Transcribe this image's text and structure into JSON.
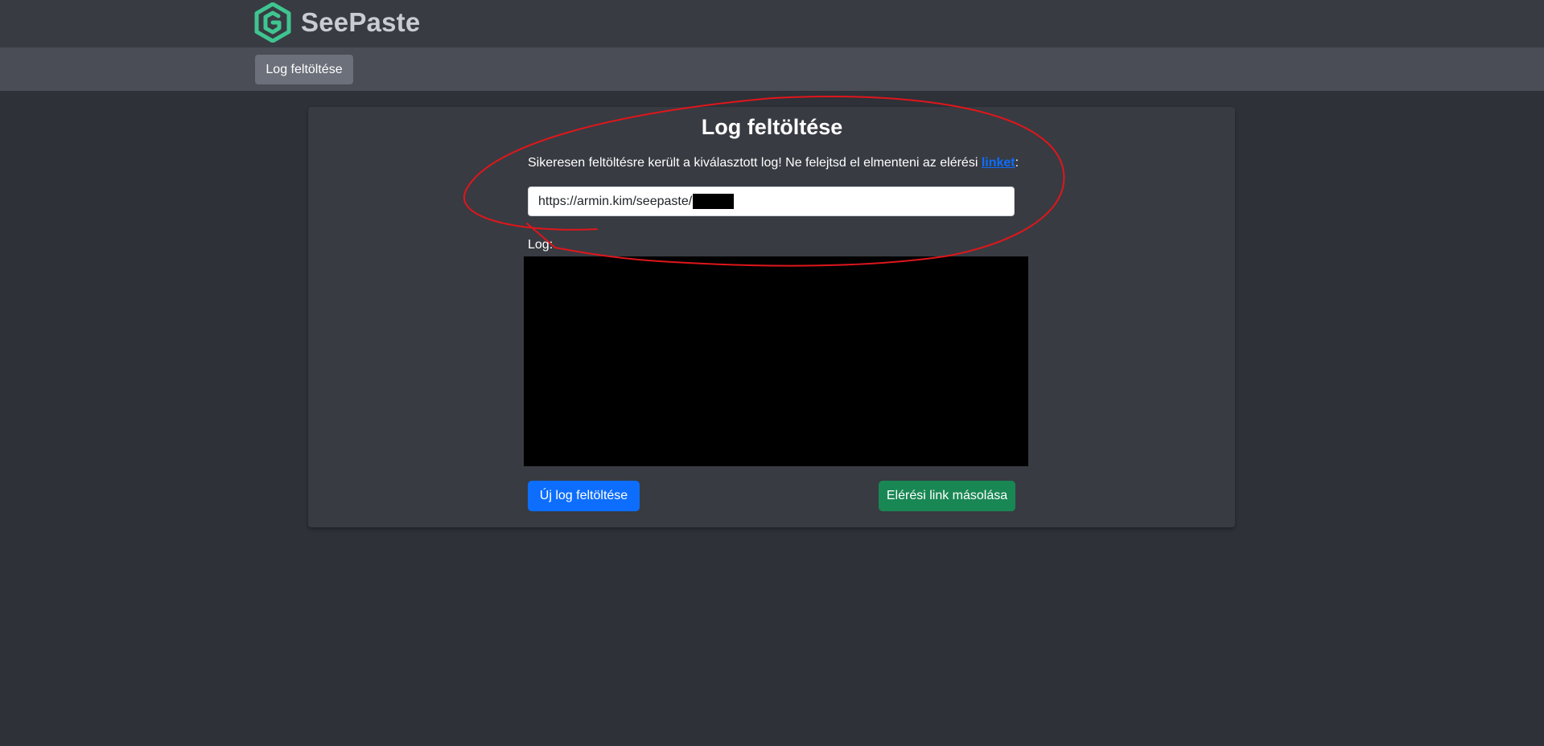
{
  "header": {
    "brand_name": "SeePaste",
    "logo_icon": "hex-logo-icon",
    "accent_color": "#3fc590"
  },
  "nav": {
    "upload_label": "Log feltöltése"
  },
  "main": {
    "title": "Log feltöltése",
    "success_text": "Sikeresen feltöltésre került a kiválasztott log! Ne felejtsd el elmenteni az elérési ",
    "success_link": "linket",
    "success_suffix": ":",
    "link_value": "https://armin.kim/seepaste/",
    "log_label": "Log:",
    "new_upload_label": "Új log feltöltése",
    "copy_link_label": "Elérési link másolása"
  },
  "colors": {
    "primary": "#0d6efd",
    "success": "#198754",
    "annotation_red": "#e0161b"
  }
}
